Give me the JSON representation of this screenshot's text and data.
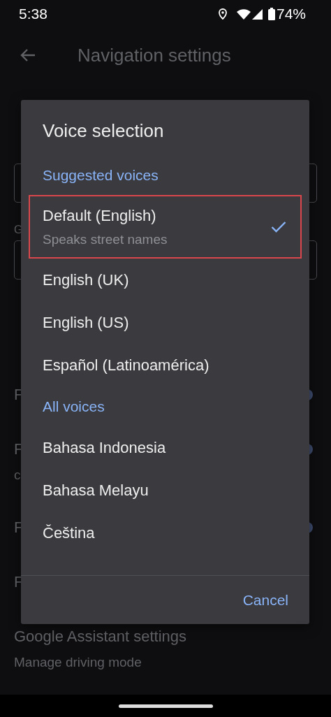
{
  "status_bar": {
    "time": "5:38",
    "battery": "74%"
  },
  "app_bar": {
    "title": "Navigation settings"
  },
  "settings": [
    {
      "kind": "heading"
    },
    {
      "kind": "label"
    },
    {
      "kind": "field"
    },
    {
      "kind": "label",
      "title": "G"
    },
    {
      "kind": "field"
    },
    {
      "kind": "setting"
    },
    {
      "kind": "setting",
      "title": "F",
      "toggle_on": true
    },
    {
      "kind": "setting",
      "title": "F",
      "subtitle": "c",
      "toggle_on": true
    },
    {
      "kind": "setting",
      "title": "F",
      "toggle_on": true
    },
    {
      "kind": "setting",
      "title": "F"
    },
    {
      "kind": "setting",
      "title": "Google Assistant settings",
      "subtitle": "Manage driving mode"
    }
  ],
  "dialog": {
    "title": "Voice selection",
    "sections": [
      {
        "header": "Suggested voices",
        "items": [
          {
            "label": "Default (English)",
            "subtitle": "Speaks street names",
            "selected": true,
            "highlighted": true
          },
          {
            "label": "English (UK)",
            "selected": false,
            "highlighted": false
          },
          {
            "label": "English (US)",
            "selected": false,
            "highlighted": false
          },
          {
            "label": "Español (Latinoamérica)",
            "selected": false,
            "highlighted": false
          }
        ]
      },
      {
        "header": "All voices",
        "items": [
          {
            "label": "Bahasa Indonesia",
            "selected": false,
            "highlighted": false
          },
          {
            "label": "Bahasa Melayu",
            "selected": false,
            "highlighted": false
          },
          {
            "label": "Čeština",
            "selected": false,
            "highlighted": false
          }
        ]
      }
    ],
    "cancel": "Cancel"
  }
}
